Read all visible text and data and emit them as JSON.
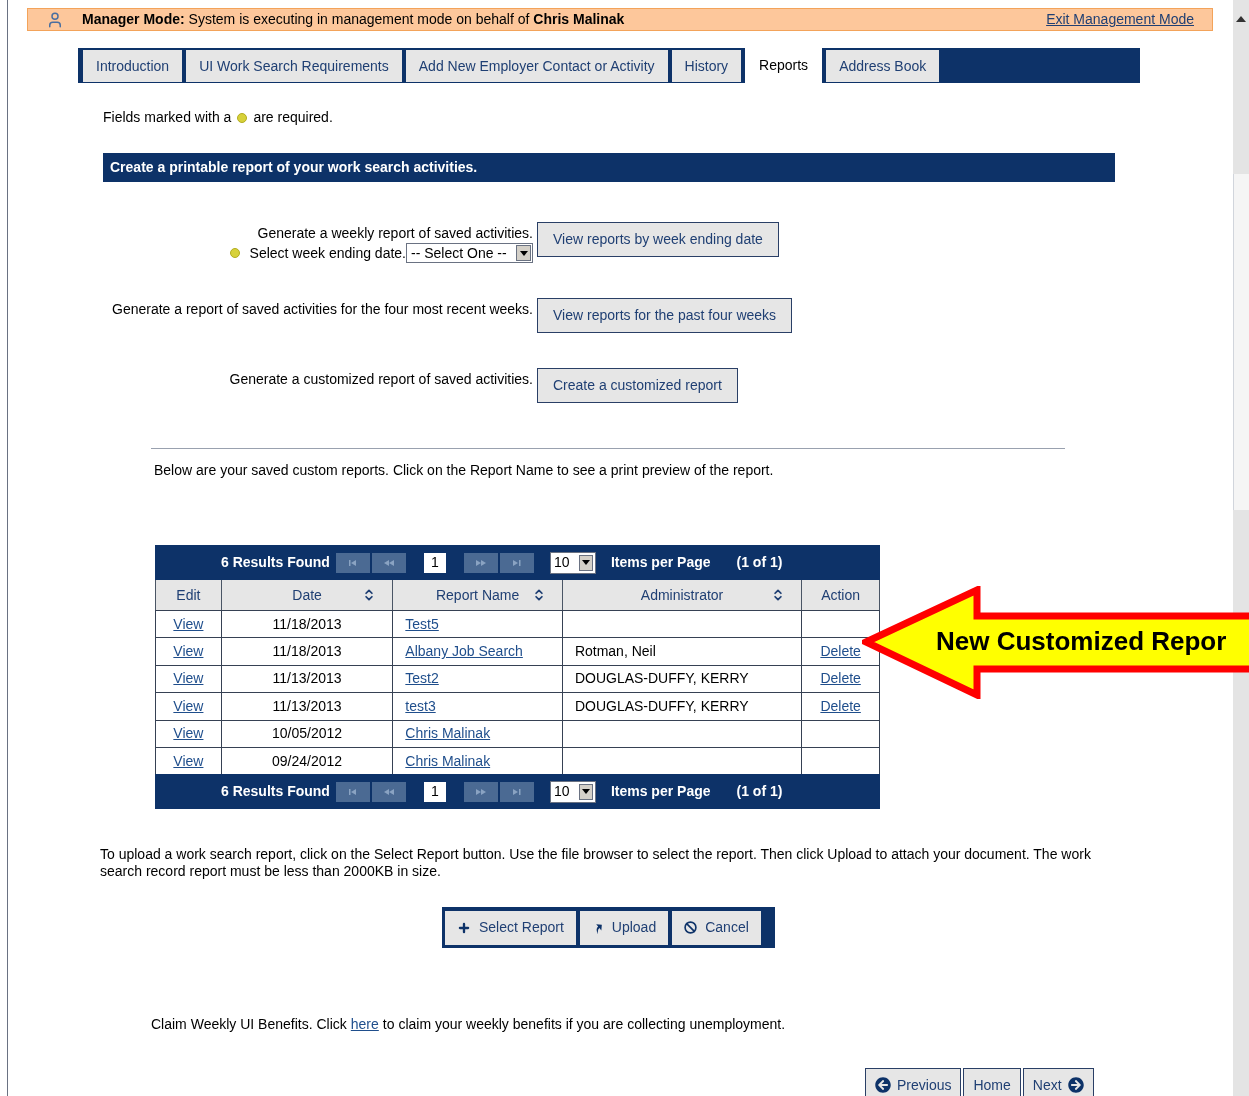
{
  "banner": {
    "text": "**Manager Mode:** System is executing in management mode on behalf of **Chris Malinak**",
    "exit_link": "Exit Management Mode"
  },
  "tabs": [
    {
      "label": "Introduction",
      "selected": false
    },
    {
      "label": "UI Work Search Requirements",
      "selected": false
    },
    {
      "label": "Add New Employer Contact or Activity",
      "selected": false
    },
    {
      "label": "History",
      "selected": false
    },
    {
      "label": "Reports",
      "selected": true
    },
    {
      "label": "Address Book",
      "selected": false
    }
  ],
  "required_note": {
    "before": "Fields marked with a",
    "after": "are required."
  },
  "section_header": "Create a printable report of your work search activities.",
  "report_options": [
    {
      "kind": "weekly",
      "lines": [
        "Generate a weekly report of saved activities.",
        "Select week ending date."
      ],
      "select": "-- Select One --",
      "button": "View reports by week ending date"
    },
    {
      "kind": "plain",
      "lines": [
        "Generate a report of saved activities for the four most recent weeks."
      ],
      "button": "View reports for the past four weeks"
    },
    {
      "kind": "plain",
      "lines": [
        "Generate a customized report of saved activities."
      ],
      "button": "Create a customized report"
    }
  ],
  "saved_intro": "Below are your saved custom reports. Click on the Report Name to see a print preview of the report.",
  "pagers": [
    {
      "results": "6 Results Found",
      "page": "1",
      "per_page": "10",
      "per_page_label": "Items per Page",
      "page_count": "(1 of 1)"
    },
    {
      "results": "6 Results Found",
      "page": "1",
      "per_page": "10",
      "per_page_label": "Items per Page",
      "page_count": "(1 of 1)"
    }
  ],
  "table": {
    "columns": [
      {
        "label": "Edit",
        "sortable": false
      },
      {
        "label": "Date",
        "sortable": true
      },
      {
        "label": "Report Name",
        "sortable": true
      },
      {
        "label": "Administrator",
        "sortable": true
      },
      {
        "label": "Action",
        "sortable": false
      }
    ],
    "rows": [
      {
        "edit": "View",
        "date": "11/18/2013",
        "name": "Test5"
      },
      {
        "edit": "View",
        "date": "11/18/2013",
        "name": "Albany Job Search",
        "admin": "Rotman, Neil",
        "action": "Delete"
      },
      {
        "edit": "View",
        "date": "11/13/2013",
        "name": "Test2",
        "admin": "DOUGLAS-DUFFY, KERRY",
        "action": "Delete"
      },
      {
        "edit": "View",
        "date": "11/13/2013",
        "name": "test3",
        "admin": "DOUGLAS-DUFFY, KERRY",
        "action": "Delete"
      },
      {
        "edit": "View",
        "date": "10/05/2012",
        "name": "Chris Malinak"
      },
      {
        "edit": "View",
        "date": "09/24/2012",
        "name": "Chris Malinak"
      }
    ]
  },
  "callout": "New Customized Repor",
  "upload_note": "To upload a work search report, click on the Select Report button. Use the file browser to select the report. Then click Upload to attach your document. The work search record report must be less than 2000KB in size.",
  "upload_buttons": [
    {
      "kind": "select",
      "label": "Select Report"
    },
    {
      "kind": "upload",
      "label": "Upload"
    },
    {
      "kind": "cancel",
      "label": "Cancel"
    }
  ],
  "claim": {
    "before": "Claim Weekly UI Benefits. Click",
    "link": "here",
    "after": "to claim your weekly benefits if you are collecting unemployment."
  },
  "nav_buttons": [
    {
      "kind": "previous",
      "label": "Previous"
    },
    {
      "kind": "home",
      "label": "Home"
    },
    {
      "kind": "next",
      "label": "Next"
    }
  ]
}
